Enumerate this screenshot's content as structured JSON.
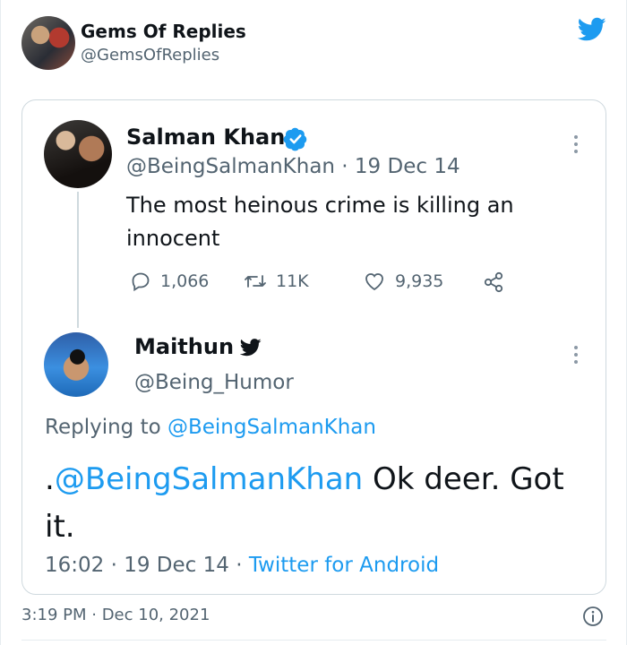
{
  "colors": {
    "accent": "#1d9bf0",
    "text": "#0f1419",
    "muted": "#536471",
    "border": "#cfd9de"
  },
  "outer": {
    "name": "Gems Of Replies",
    "handle": "@GemsOfReplies",
    "timestamp": "3:19 PM · Dec 10, 2021",
    "brand_icon": "twitter-bird-icon",
    "info_icon": "info-icon"
  },
  "original_tweet": {
    "name": "Salman Khan",
    "verified": true,
    "handle_date": "@BeingSalmanKhan · 19 Dec 14",
    "text": "The most heinous crime is killing an innocent",
    "replies": "1,066",
    "retweets": "11K",
    "likes": "9,935"
  },
  "reply_tweet": {
    "name": "Maithun",
    "handle": "@Being_Humor",
    "replying_prefix": "Replying to ",
    "replying_to": "@BeingSalmanKhan",
    "text_prefix": ".",
    "text_mention": "@BeingSalmanKhan",
    "text_body": " Ok deer. Got it.",
    "time": "16:02 · 19 Dec 14 · ",
    "source": "Twitter for Android"
  }
}
